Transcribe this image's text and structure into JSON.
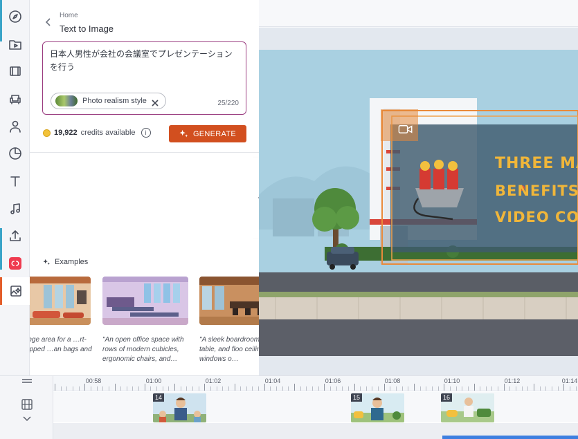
{
  "sidebar": {
    "icons": [
      "compass-icon",
      "folder-media-icon",
      "film-icon",
      "armchair-icon",
      "person-icon",
      "pie-chart-icon",
      "text-icon",
      "music-icon",
      "upload-icon",
      "brand-app-icon",
      "ai-image-icon"
    ]
  },
  "panel": {
    "breadcrumb": "Home",
    "title": "Text to Image",
    "prompt": "日本人男性が会社の会議室でプレゼンテーションを行う",
    "style_chip": "Photo realism style",
    "char_count": "25/220",
    "credits_value": "19,922",
    "credits_suffix": "credits available",
    "info_glyph": "i",
    "generate_label": "GENERATE",
    "examples_label": "Examples",
    "examples": [
      {
        "caption": "…ly lounge area for a …rt-up, equipped …an bags and a…"
      },
      {
        "caption": "\"An open office space with rows of modern cubicles, ergonomic chairs, and…"
      },
      {
        "caption": "\"A sleek boardroom long table, and floo ceiling windows o…"
      }
    ]
  },
  "scene": {
    "headline_1": "THREE MA",
    "headline_2": "BENEFITS",
    "headline_3": "VIDEO CON"
  },
  "timeline": {
    "ticks": [
      "00:58",
      "01:00",
      "01:02",
      "01:04",
      "01:06",
      "01:08",
      "01:10",
      "01:12",
      "01:14"
    ],
    "clips": [
      {
        "number": "14"
      },
      {
        "number": "15"
      },
      {
        "number": "16"
      }
    ]
  },
  "colors": {
    "accent": "#d24f1f",
    "prompt_border": "#9a3c80",
    "headline": "#f0b63a",
    "timeline_bar": "#3d7fe0"
  }
}
